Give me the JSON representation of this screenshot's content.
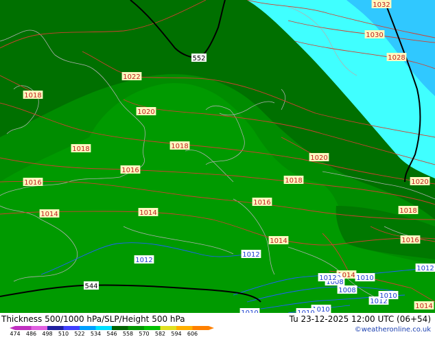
{
  "footer": {
    "title": "Thickness 500/1000 hPa/SLP/Height 500 hPa",
    "valid_time": "Tu 23-12-2025 12:00 UTC (06+54)",
    "credit": "©weatheronline.co.uk"
  },
  "legend": {
    "thickness_ticks": [
      "474",
      "486",
      "498",
      "510",
      "522",
      "534",
      "546",
      "558",
      "570",
      "582",
      "594",
      "606"
    ],
    "colors": [
      "#c030c0",
      "#e060e0",
      "#2020a0",
      "#4040ff",
      "#00a0ff",
      "#00e0ff",
      "#006400",
      "#009600",
      "#00c000",
      "#e0e020",
      "#ffb000",
      "#ff8000"
    ]
  },
  "map": {
    "colors": {
      "dark_green": "#007000",
      "mid_green": "#008c00",
      "light_green": "#009a00",
      "cyan": "#40ffff",
      "sky": "#30c8ff",
      "isobar": "#d04030",
      "isobar_low": "#2060ff",
      "height_line": "#000000",
      "coast": "#b0b0b0"
    },
    "height_labels": [
      "552",
      "544"
    ],
    "isobar_labels": [
      "1032",
      "1030",
      "1028",
      "1022",
      "1020",
      "1020",
      "1018",
      "1018",
      "1018",
      "1016",
      "1016",
      "1016",
      "1020",
      "1018",
      "1014",
      "1014",
      "1016",
      "1018",
      "1016",
      "1014",
      "1020",
      "1014",
      "1014",
      "1012",
      "1012",
      "1012",
      "1010",
      "1008",
      "1010",
      "1008",
      "1012",
      "1010",
      "1012",
      "1010",
      "1010",
      "1010",
      "1012"
    ]
  }
}
